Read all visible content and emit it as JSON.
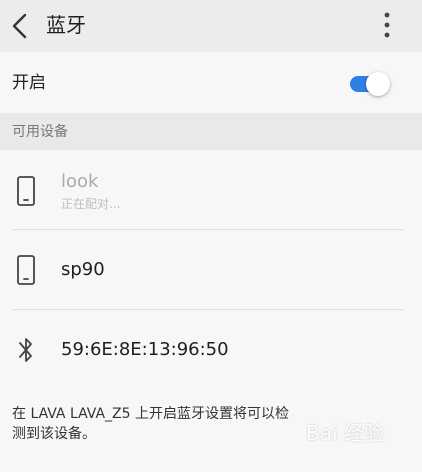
{
  "appbar": {
    "title": "蓝牙",
    "back_icon": "chevron-left-icon",
    "more_icon": "more-vertical-icon"
  },
  "bluetooth_toggle": {
    "label": "开启",
    "enabled": true,
    "accent_color": "#2f7ee6"
  },
  "available_devices": {
    "header": "可用设备",
    "devices": [
      {
        "name": "look",
        "status": "正在配对...",
        "icon": "phone-icon"
      },
      {
        "name": "sp90",
        "status": "",
        "icon": "phone-icon"
      },
      {
        "name": "59:6E:8E:13:96:50",
        "status": "",
        "icon": "bluetooth-icon"
      }
    ]
  },
  "footer": {
    "text": "在 LAVA LAVA_Z5 上开启蓝牙设置将可以检测到该设备。"
  },
  "watermark": {
    "text": "Bai 经验"
  }
}
